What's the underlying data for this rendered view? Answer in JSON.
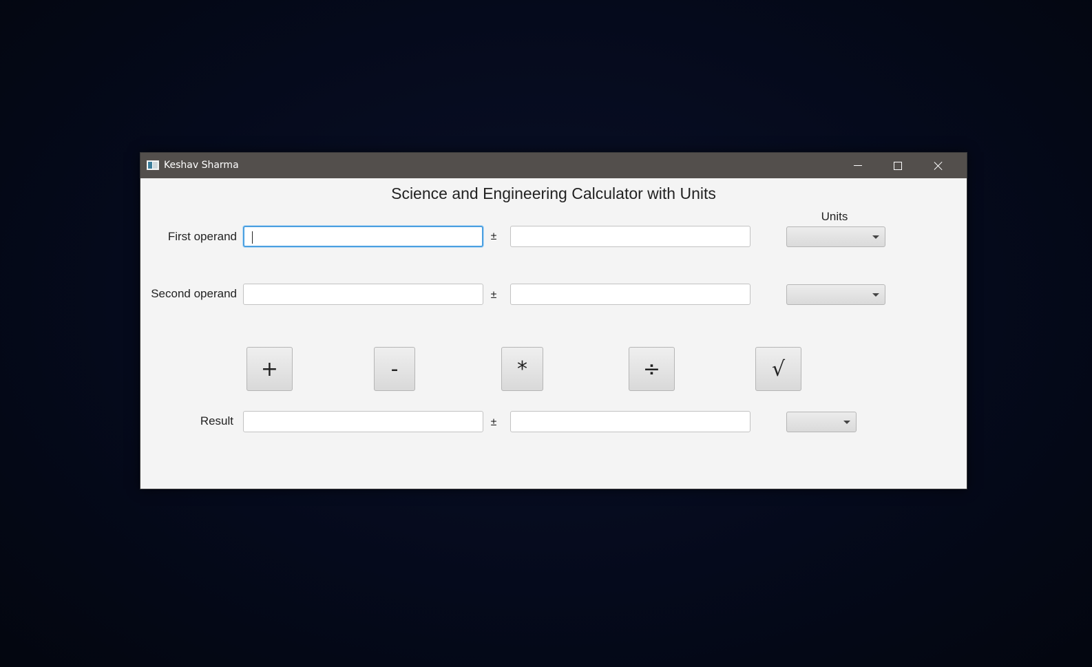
{
  "window": {
    "title": "Keshav Sharma"
  },
  "app": {
    "heading": "Science and Engineering Calculator with Units",
    "units_header": "Units"
  },
  "rows": {
    "first": {
      "label": "First operand",
      "value": "",
      "pm": "±",
      "uncertainty": "",
      "unit": ""
    },
    "second": {
      "label": "Second operand",
      "value": "",
      "pm": "±",
      "uncertainty": "",
      "unit": ""
    },
    "result": {
      "label": "Result",
      "value": "",
      "pm": "±",
      "uncertainty": "",
      "unit": ""
    }
  },
  "operations": {
    "add": "+",
    "subtract": "-",
    "multiply": "*",
    "divide": "÷",
    "sqrt": "√"
  },
  "icons": {
    "app": "app-window-icon",
    "minimize": "minimize-icon",
    "maximize": "maximize-icon",
    "close": "close-icon",
    "dropdown": "chevron-down-icon"
  },
  "colors": {
    "titlebar": "#534f4c",
    "window_bg": "#f4f4f4",
    "focus_ring": "#4a9fe0",
    "desktop_bg": "#050a1c"
  }
}
